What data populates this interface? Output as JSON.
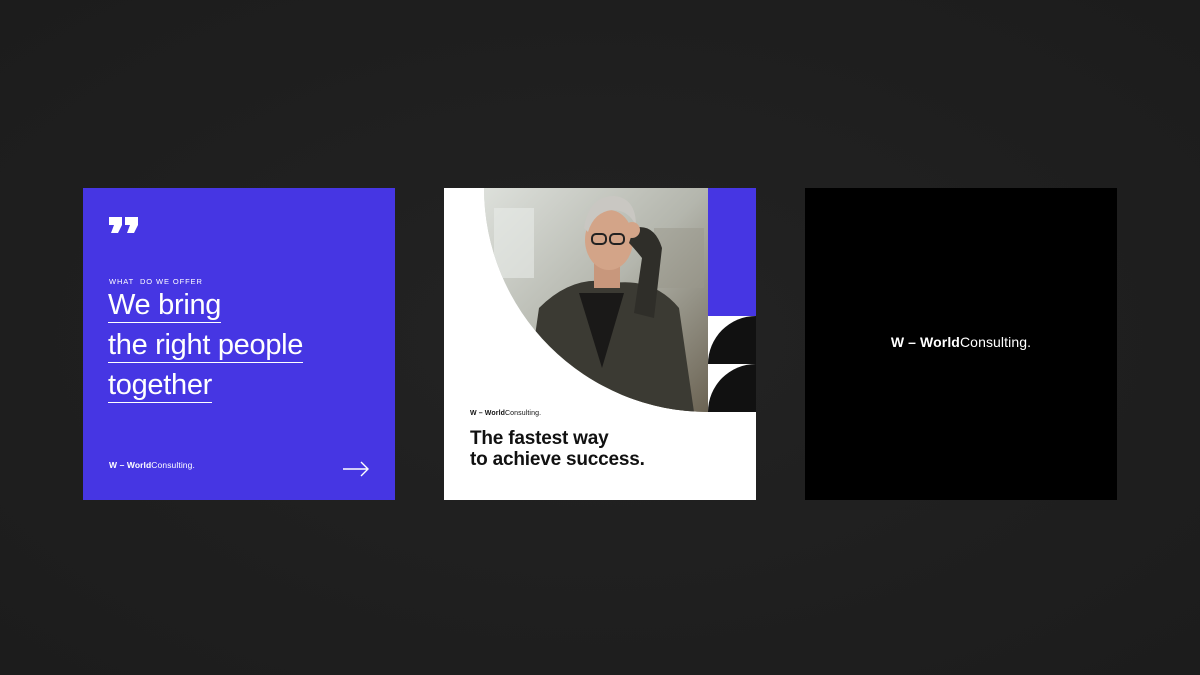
{
  "colors": {
    "background": "#1e1e1e",
    "brand_blue": "#4636e3",
    "white": "#ffffff",
    "black": "#000000"
  },
  "card_blue": {
    "eyebrow": "WHAT  DO WE OFFER",
    "headline_lines": [
      "We bring",
      "the right people",
      "together"
    ],
    "brand_bold": "W – World",
    "brand_regular": "Consulting.",
    "quote_icon": "quote-icon",
    "arrow_icon": "arrow-right-icon"
  },
  "card_white": {
    "brand_bold": "W – World",
    "brand_regular": "Consulting.",
    "tagline_lines": [
      "The fastest way",
      "to achieve success."
    ],
    "photo": "portrait-photo"
  },
  "card_black": {
    "brand_bold": "W – World",
    "brand_regular": "Consulting."
  }
}
